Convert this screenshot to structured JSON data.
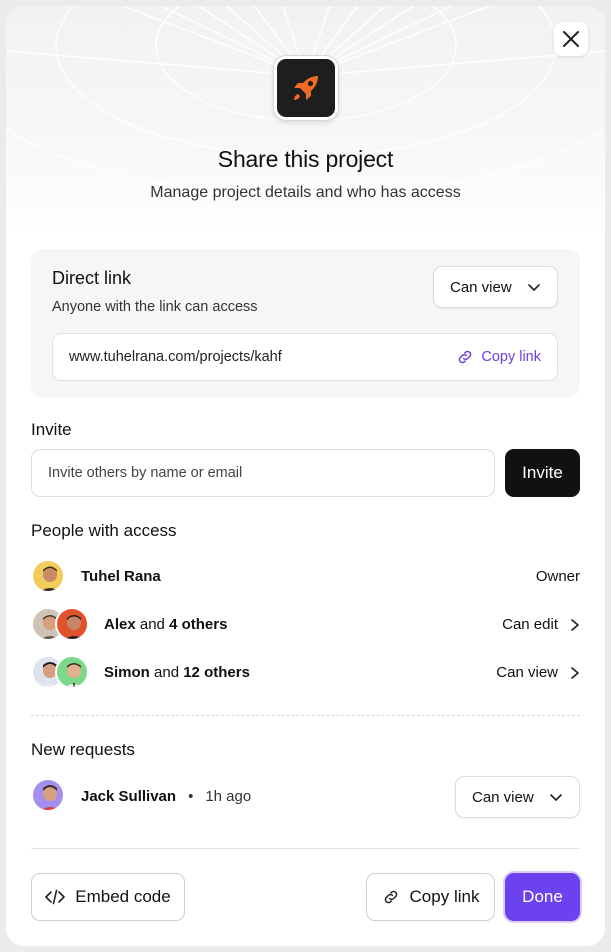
{
  "header": {
    "title": "Share this project",
    "subtitle": "Manage project details and who has access",
    "app_icon": "rocket-icon",
    "close_icon": "close-icon"
  },
  "direct_link": {
    "title": "Direct link",
    "description": "Anyone with the link can access",
    "permission": "Can view",
    "url": "www.tuhelrana.com/projects/kahf",
    "copy_label": "Copy link"
  },
  "invite": {
    "label": "Invite",
    "placeholder": "Invite others by name or email",
    "button_label": "Invite"
  },
  "people": {
    "label": "People with access",
    "rows": [
      {
        "name": "Tuhel Rana",
        "conj": "",
        "others": "",
        "role": "Owner"
      },
      {
        "name": "Alex",
        "conj": " and ",
        "others": "4 others",
        "role": "Can edit"
      },
      {
        "name": "Simon",
        "conj": " and ",
        "others": "12 others",
        "role": "Can view"
      }
    ]
  },
  "requests": {
    "label": "New requests",
    "items": [
      {
        "name": "Jack Sullivan",
        "separator": "•",
        "time": "1h ago",
        "permission": "Can view"
      }
    ]
  },
  "footer": {
    "embed_label": "Embed code",
    "copy_label": "Copy link",
    "done_label": "Done"
  },
  "colors": {
    "accent": "#6b42ee",
    "link": "#6a40e0",
    "rocket": "#f26b22",
    "dark": "#111111"
  }
}
